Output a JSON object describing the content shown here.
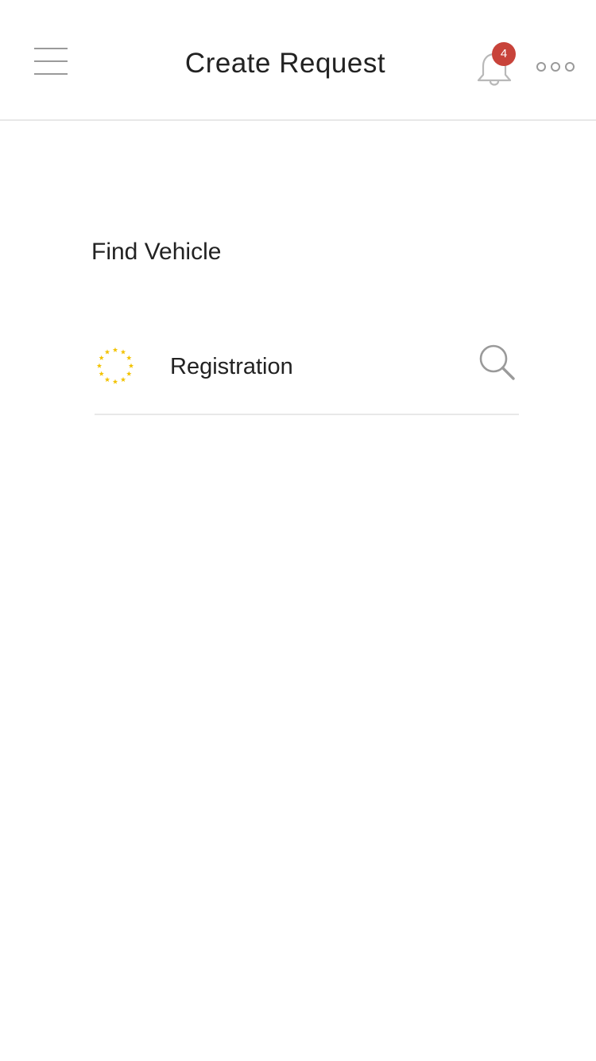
{
  "header": {
    "title": "Create Request",
    "notification_count": "4",
    "icons": {
      "menu": "hamburger-menu-icon",
      "notifications": "bell-icon",
      "more": "more-dots-icon"
    }
  },
  "main": {
    "section_label": "Find Vehicle",
    "registration": {
      "placeholder": "Registration",
      "value": "",
      "flag_icon": "eu-stars-icon",
      "search_icon": "search-icon"
    }
  },
  "colors": {
    "badge": "#c8433a",
    "icon_gray": "#9a9a9a",
    "divider": "#e8e8e8",
    "eu_star": "#f2c200"
  }
}
